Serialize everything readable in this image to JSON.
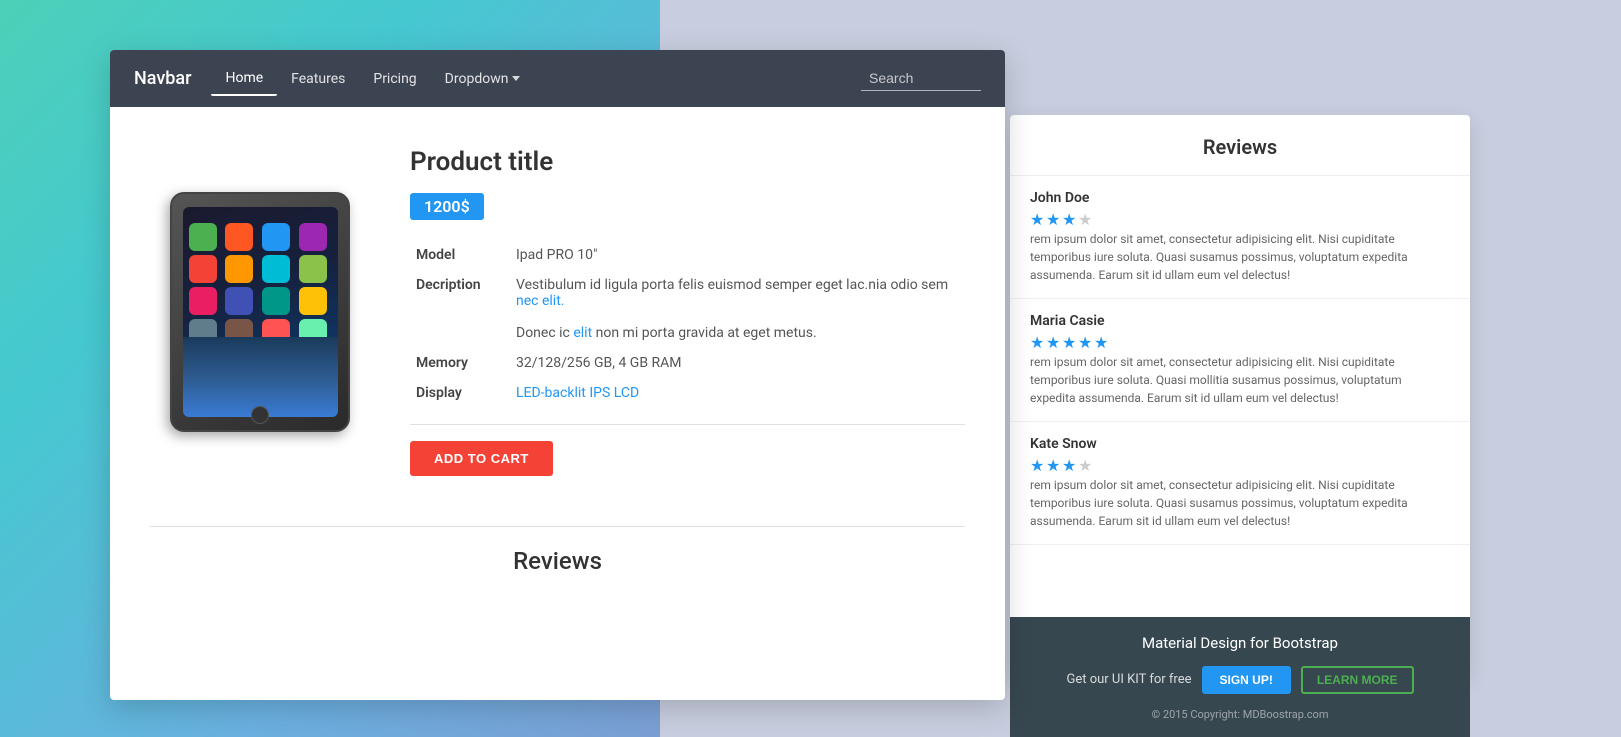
{
  "background": {
    "gradient_start": "#4dd0b8",
    "gradient_end": "#7b9fd4",
    "right_bg": "#c8cedf"
  },
  "navbar": {
    "brand": "Navbar",
    "links": [
      {
        "label": "Home",
        "active": true
      },
      {
        "label": "Features",
        "active": false
      },
      {
        "label": "Pricing",
        "active": false
      },
      {
        "label": "Dropdown",
        "active": false,
        "hasDropdown": true
      }
    ],
    "search_placeholder": "Search"
  },
  "product": {
    "title": "Product title",
    "price": "1200$",
    "specs": [
      {
        "label": "Model",
        "value": "Ipad PRO 10\""
      },
      {
        "label": "Decription",
        "value1": "Vestibulum id ligula porta felis euismod semper eget lac.nia odio sem ",
        "link": "nec elit.",
        "value2": "\nDonec ic ",
        "link2": "elit",
        "value3": " non mi porta gravida at eget metus."
      },
      {
        "label": "Memory",
        "value": "32/128/256 GB, 4 GB RAM"
      },
      {
        "label": "Display",
        "value": "LED-backlit IPS LCD"
      }
    ],
    "add_to_cart": "ADD TO CART"
  },
  "reviews_section": {
    "title": "Reviews"
  },
  "back_card": {
    "reviews_title": "Reviews",
    "reviews": [
      {
        "name": "John Doe",
        "stars": 3,
        "text": "rem ipsum dolor sit amet, consectetur adipisicing elit. Nisi cupiditate temporibus iure soluta. Quasi susamus possimus, voluptatum expedita assumenda. Earum sit id ullam eum vel delectus!"
      },
      {
        "name": "Maria Casie",
        "stars": 5,
        "text": "rem ipsum dolor sit amet, consectetur adipisicing elit. Nisi cupiditate temporibus iure soluta. Quasi mollitia susamus possimus, voluptatum expedita assumenda. Earum sit id ullam eum vel delectus!"
      },
      {
        "name": "Kate Snow",
        "stars": 3,
        "text": "rem ipsum dolor sit amet, consectetur adipisicing elit. Nisi cupiditate temporibus iure soluta. Quasi susamus possimus, voluptatum expedita assumenda. Earum sit id ullam eum vel delectus!"
      }
    ]
  },
  "cta": {
    "title": "Material Design for Bootstrap",
    "get_kit_text": "Get our UI KIT for free",
    "signup_label": "SIGN UP!",
    "learn_label": "LEARN MORE",
    "copyright": "© 2015 Copyright: MDBoostrap.com"
  }
}
